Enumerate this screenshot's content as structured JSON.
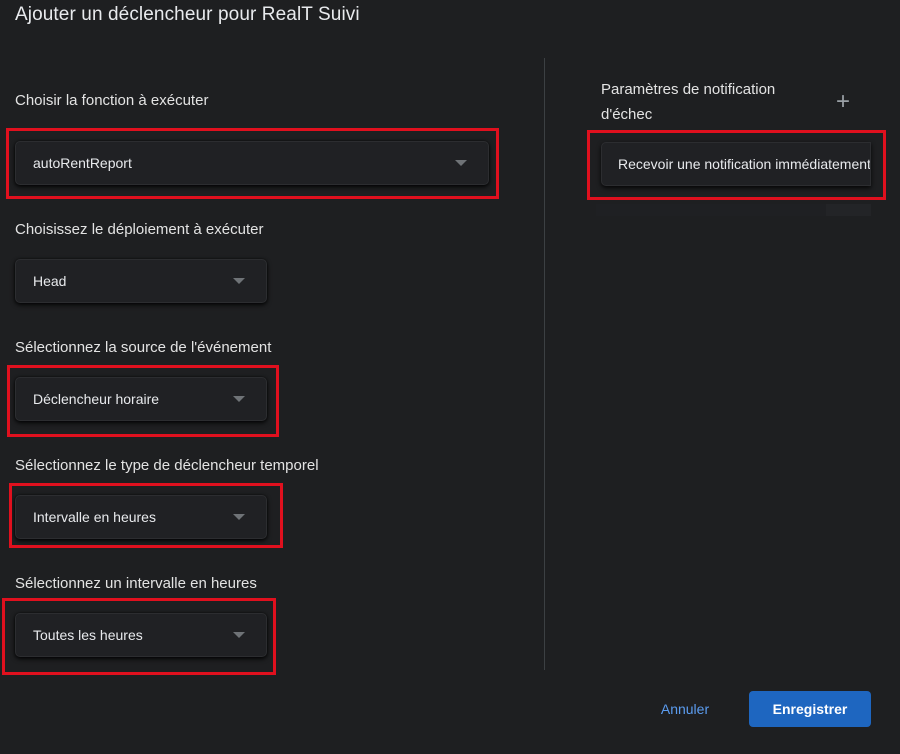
{
  "dialog": {
    "title": "Ajouter un déclencheur pour RealT Suivi"
  },
  "fields": {
    "function": {
      "label": "Choisir la fonction à exécuter",
      "value": "autoRentReport"
    },
    "deployment": {
      "label": "Choisissez le déploiement à exécuter",
      "value": "Head"
    },
    "event_source": {
      "label": "Sélectionnez la source de l'événement",
      "value": "Déclencheur horaire"
    },
    "trigger_type": {
      "label": "Sélectionnez le type de déclencheur temporel",
      "value": "Intervalle en heures"
    },
    "interval": {
      "label": "Sélectionnez un intervalle en heures",
      "value": "Toutes les heures"
    }
  },
  "failure_notification": {
    "label": "Paramètres de notification d'échec",
    "value": "Recevoir une notification immédiatement",
    "add_icon": "plus-icon"
  },
  "actions": {
    "cancel_label": "Annuler",
    "save_label": "Enregistrer"
  },
  "colors": {
    "background": "#1e1f21",
    "highlight": "#e0101e",
    "primary": "#1e66c0",
    "link": "#5b9cf0"
  }
}
